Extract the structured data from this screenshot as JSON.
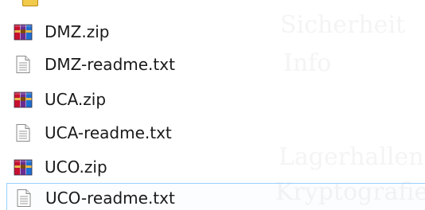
{
  "files": [
    {
      "name": "DMZ.zip",
      "type": "zip-archive",
      "icon": "winrar-archive-icon",
      "selected": false
    },
    {
      "name": "DMZ-readme.txt",
      "type": "text-document",
      "icon": "text-file-icon",
      "selected": false
    },
    {
      "name": "UCA.zip",
      "type": "zip-archive",
      "icon": "winrar-archive-icon",
      "selected": false
    },
    {
      "name": "UCA-readme.txt",
      "type": "text-document",
      "icon": "text-file-icon",
      "selected": false
    },
    {
      "name": "UCO.zip",
      "type": "zip-archive",
      "icon": "winrar-archive-icon",
      "selected": false
    },
    {
      "name": "UCO-readme.txt",
      "type": "text-document",
      "icon": "text-file-icon",
      "selected": true
    }
  ],
  "colors": {
    "selection_border": "#99d1ff",
    "label_text": "#1a1a1a",
    "archive_red": "#c8102e",
    "archive_purple": "#6b2c91",
    "archive_blue": "#1d6fd1",
    "archive_band": "#e8b84a"
  }
}
